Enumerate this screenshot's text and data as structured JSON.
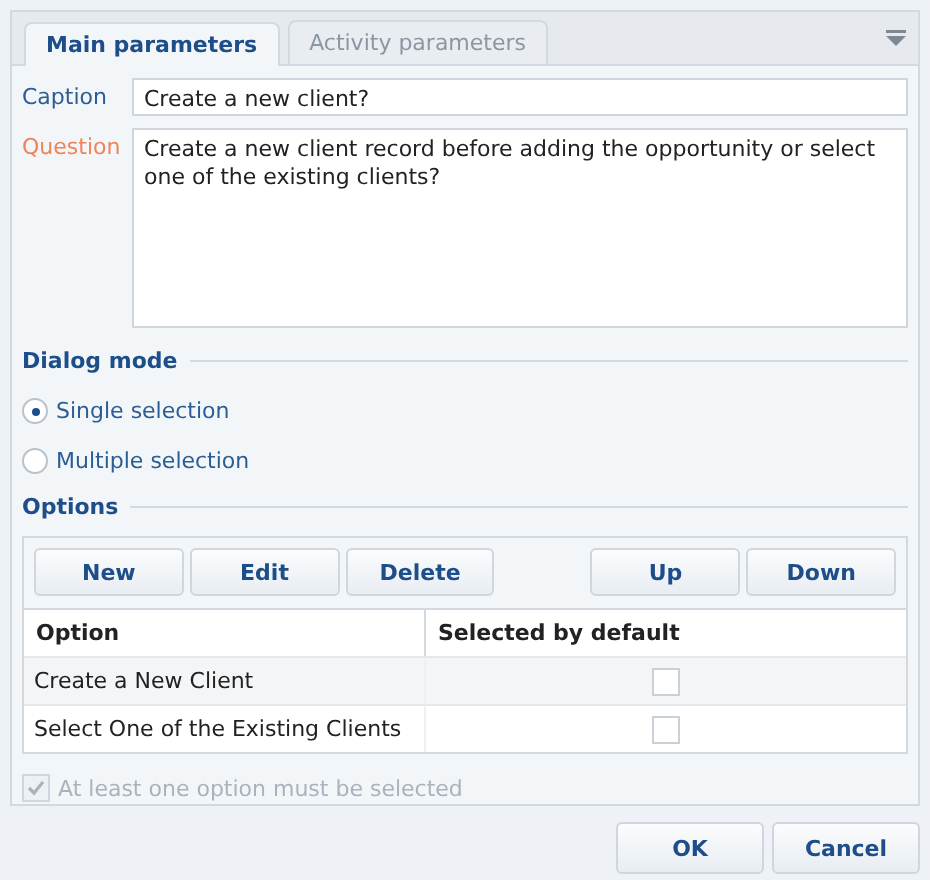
{
  "tabs": [
    {
      "label": "Main parameters",
      "selected": true
    },
    {
      "label": "Activity parameters",
      "selected": false
    }
  ],
  "fields": [
    {
      "kind": "line",
      "label": "Caption",
      "required": false,
      "value": "Create a new client?"
    },
    {
      "kind": "memo",
      "label": "Question",
      "required": true,
      "value": "Create a new client record before adding the opportunity or select one of the existing clients?"
    }
  ],
  "dialog_mode": {
    "title": "Dialog mode",
    "options": [
      {
        "label": "Single selection",
        "selected": true
      },
      {
        "label": "Multiple selection",
        "selected": false
      }
    ]
  },
  "options": {
    "title": "Options",
    "toolbar_left": [
      "New",
      "Edit",
      "Delete"
    ],
    "toolbar_right": [
      "Up",
      "Down"
    ],
    "columns": [
      "Option",
      "Selected by default"
    ],
    "rows": [
      {
        "option": "Create a New Client",
        "checked": false
      },
      {
        "option": "Select One of the Existing Clients",
        "checked": false
      }
    ],
    "required_check": {
      "label": "At least one option must be selected",
      "checked": true,
      "disabled": true
    }
  },
  "buttons": [
    "OK",
    "Cancel"
  ]
}
